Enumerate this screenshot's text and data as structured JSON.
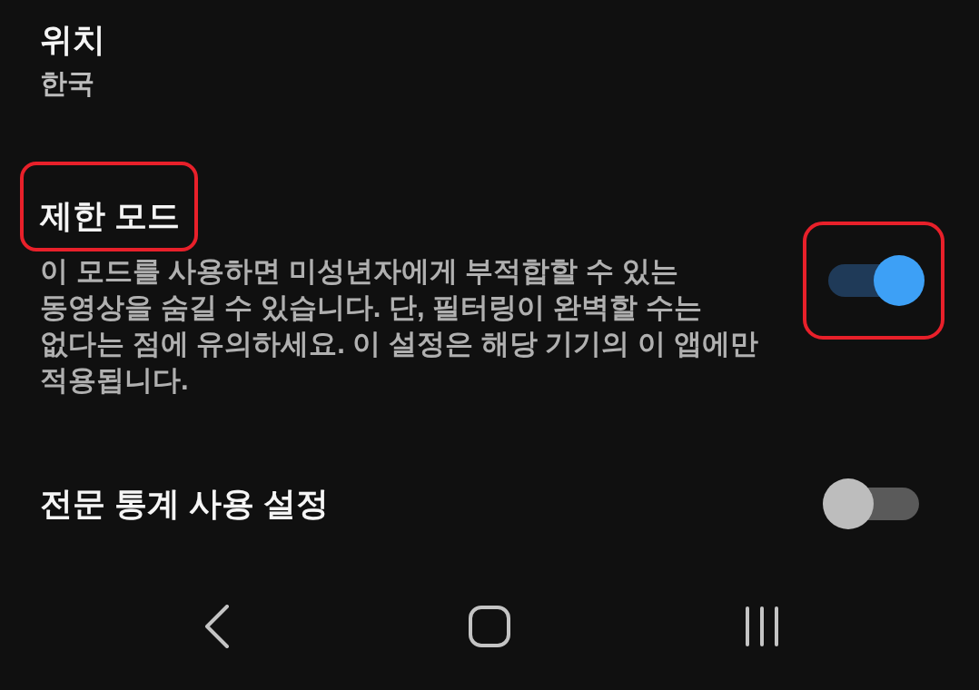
{
  "settings": [
    {
      "kind": "value",
      "title": "위치",
      "value": "한국"
    },
    {
      "kind": "toggle",
      "title": "제한 모드",
      "title_highlighted": true,
      "description": "이 모드를 사용하면 미성년자에게 부적합할 수 있는 동영상을 숨길 수 있습니다. 단, 필터링이 완벽할 수는 없다는 점에 유의하세요. 이 설정은 해당 기기의 이 앱에만 적용됩니다.",
      "on": true,
      "toggle_highlighted": true
    },
    {
      "kind": "toggle",
      "title": "전문 통계 사용 설정",
      "title_highlighted": false,
      "on": false,
      "toggle_highlighted": false
    }
  ]
}
